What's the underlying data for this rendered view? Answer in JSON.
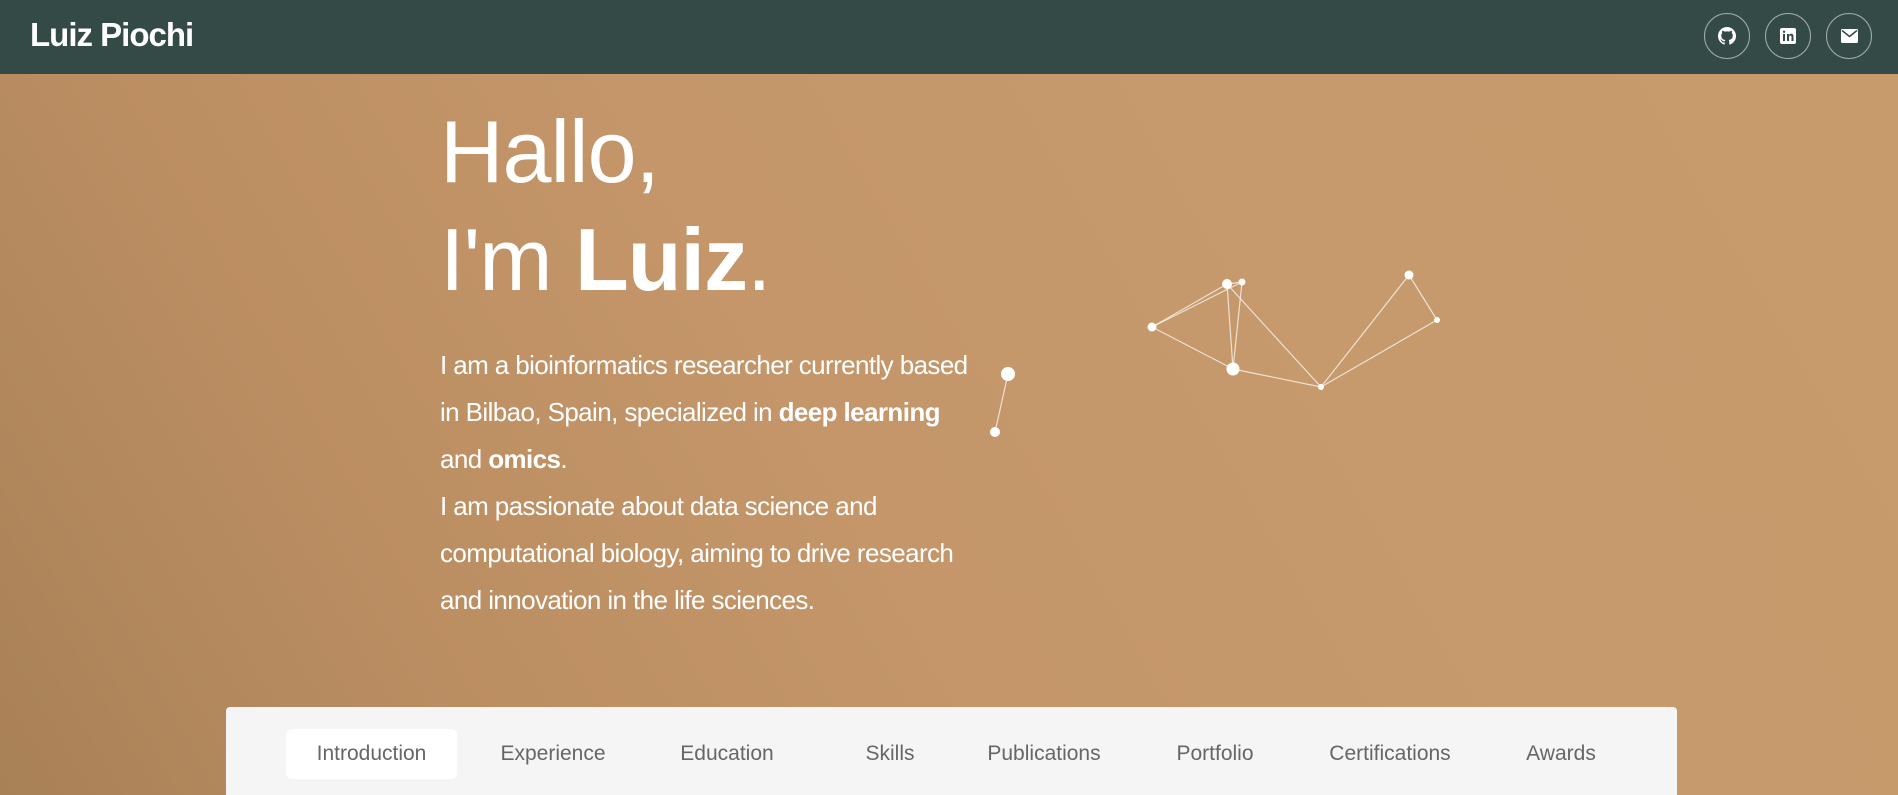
{
  "header": {
    "brand": "Luiz Piochi",
    "social": [
      {
        "icon": "github-icon"
      },
      {
        "icon": "linkedin-icon"
      },
      {
        "icon": "envelope-icon"
      }
    ]
  },
  "hero": {
    "line1": "Hallo,",
    "line2_prefix": "I'm ",
    "line2_name": "Luiz",
    "line2_suffix": ".",
    "bio": {
      "p1_a": "I am a bioinformatics researcher currently based in Bilbao, Spain, specialized in ",
      "p1_b": "deep learning",
      "p1_c": " and ",
      "p1_d": "omics",
      "p1_e": ".",
      "p2": "I am passionate about data science and computational biology, aiming to drive research and innovation in the life sciences."
    }
  },
  "tabs": {
    "items": [
      {
        "label": "Introduction"
      },
      {
        "label": "Experience"
      },
      {
        "label": "Education"
      },
      {
        "label": "Skills"
      },
      {
        "label": "Publications"
      },
      {
        "label": "Portfolio"
      },
      {
        "label": "Certifications"
      },
      {
        "label": "Awards"
      }
    ],
    "active": "Introduction"
  },
  "colors": {
    "navbar": "#344a46",
    "hero": "#c4966a",
    "tab_panel": "#f5f5f5"
  }
}
